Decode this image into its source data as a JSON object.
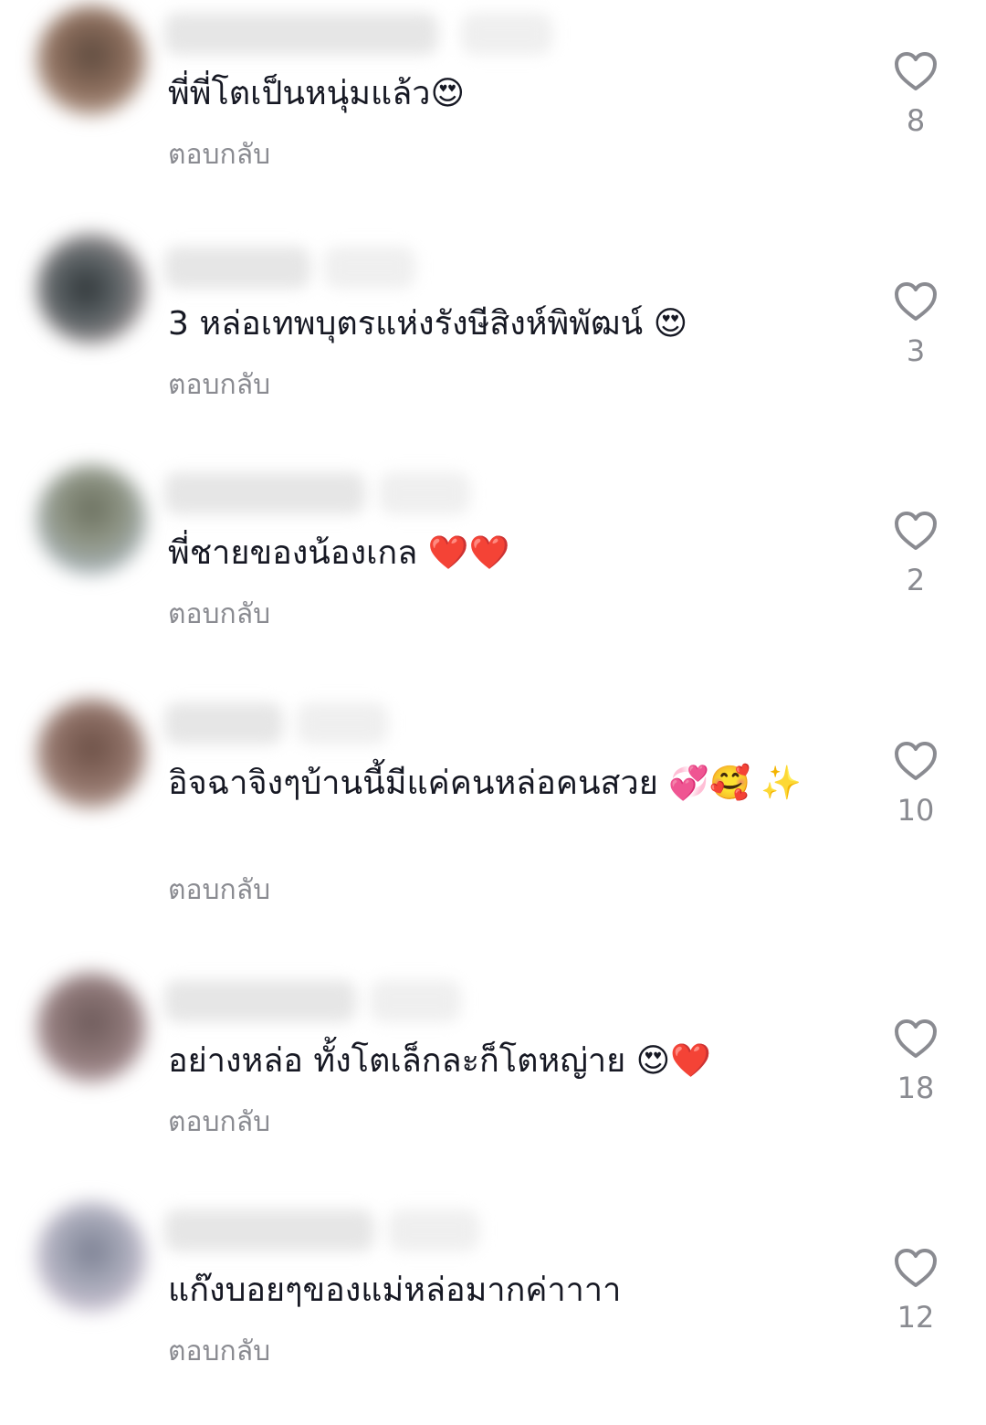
{
  "comments": [
    {
      "text": "พี่พี่โตเป็นหนุ่มแล้ว😍",
      "reply_label": "ตอบกลับ",
      "likes": "8",
      "avatar_colors": [
        "#5d4a3e",
        "#a8887a"
      ]
    },
    {
      "text": "3 หล่อเทพบุตรแห่งรังษีสิงห์พิพัฒน์ 😍",
      "reply_label": "ตอบกลับ",
      "likes": "3",
      "avatar_colors": [
        "#2f3538",
        "#b8a6a6"
      ]
    },
    {
      "text": "พี่ชายของน้องเกล ❤️❤️",
      "reply_label": "ตอบกลับ",
      "likes": "2",
      "avatar_colors": [
        "#6a6f5e",
        "#9fb2c8"
      ]
    },
    {
      "text": "อิจฉาจิงๆบ้านนี้มีแค่คนหล่อคนสวย 💞🥰 ✨",
      "reply_label": "ตอบกลับ",
      "likes": "10",
      "avatar_colors": [
        "#6b4f45",
        "#b7998e"
      ]
    },
    {
      "text": "อย่างหล่อ ทั้งโตเล็กละก็โตหญ่าย 😍❤️",
      "reply_label": "ตอบกลับ",
      "likes": "18",
      "avatar_colors": [
        "#6d5a5a",
        "#b49a9a"
      ]
    },
    {
      "text": "แก๊งบอยๆของแม่หล่อมากค่าาาา",
      "reply_label": "ตอบกลับ",
      "likes": "12",
      "avatar_colors": [
        "#7b7f92",
        "#d9c7d9"
      ]
    }
  ],
  "colors": {
    "text": "#161823",
    "secondary": "#8a8b91",
    "heart_outline": "#8a8b91"
  }
}
